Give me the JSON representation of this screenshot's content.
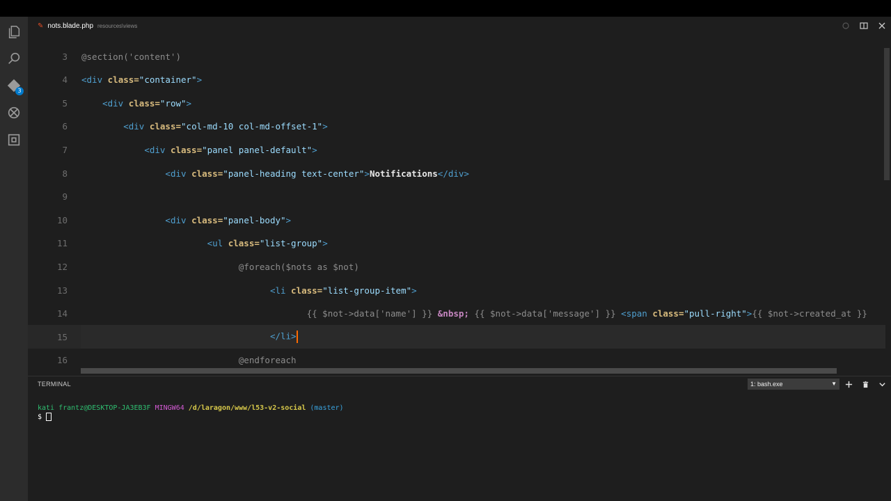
{
  "tab": {
    "filename": "nots.blade.php",
    "path": "resources\\views",
    "icon": "html-file-icon"
  },
  "activity_bar": {
    "items": [
      {
        "name": "explorer-icon"
      },
      {
        "name": "search-icon"
      },
      {
        "name": "source-control-icon",
        "badge": "3"
      },
      {
        "name": "debug-icon"
      },
      {
        "name": "extensions-icon"
      }
    ]
  },
  "editor": {
    "current_line": "15",
    "lines": [
      {
        "num": "3",
        "t": [
          [
            "blade",
            "@section('content')"
          ]
        ]
      },
      {
        "num": "4",
        "t": [
          [
            "tag",
            "<div "
          ],
          [
            "attr",
            "class="
          ],
          [
            "str",
            "\"container\""
          ],
          [
            "tag",
            ">"
          ]
        ]
      },
      {
        "num": "5",
        "t": [
          [
            "text",
            "    "
          ],
          [
            "tag",
            "<div "
          ],
          [
            "attr",
            "class="
          ],
          [
            "str",
            "\"row\""
          ],
          [
            "tag",
            ">"
          ]
        ]
      },
      {
        "num": "6",
        "t": [
          [
            "text",
            "        "
          ],
          [
            "tag",
            "<div "
          ],
          [
            "attr",
            "class="
          ],
          [
            "str",
            "\"col-md-10 col-md-offset-1\""
          ],
          [
            "tag",
            ">"
          ]
        ]
      },
      {
        "num": "7",
        "t": [
          [
            "text",
            "            "
          ],
          [
            "tag",
            "<div "
          ],
          [
            "attr",
            "class="
          ],
          [
            "str",
            "\"panel panel-default\""
          ],
          [
            "tag",
            ">"
          ]
        ]
      },
      {
        "num": "8",
        "t": [
          [
            "text",
            "                "
          ],
          [
            "tag",
            "<div "
          ],
          [
            "attr",
            "class="
          ],
          [
            "str",
            "\"panel-heading text-center\""
          ],
          [
            "tag",
            ">"
          ],
          [
            "text",
            "Notifications"
          ],
          [
            "tag",
            "</div>"
          ]
        ]
      },
      {
        "num": "9",
        "t": []
      },
      {
        "num": "10",
        "t": [
          [
            "text",
            "                "
          ],
          [
            "tag",
            "<div "
          ],
          [
            "attr",
            "class="
          ],
          [
            "str",
            "\"panel-body\""
          ],
          [
            "tag",
            ">"
          ]
        ]
      },
      {
        "num": "11",
        "t": [
          [
            "text",
            "                        "
          ],
          [
            "tag",
            "<ul "
          ],
          [
            "attr",
            "class="
          ],
          [
            "str",
            "\"list-group\""
          ],
          [
            "tag",
            ">"
          ]
        ]
      },
      {
        "num": "12",
        "t": [
          [
            "text",
            "                              "
          ],
          [
            "blade",
            "@foreach($nots as $not)"
          ]
        ]
      },
      {
        "num": "13",
        "t": [
          [
            "text",
            "                                    "
          ],
          [
            "tag",
            "<li "
          ],
          [
            "attr",
            "class="
          ],
          [
            "str",
            "\"list-group-item\""
          ],
          [
            "tag",
            ">"
          ]
        ]
      },
      {
        "num": "14",
        "t": [
          [
            "text",
            "                                           "
          ],
          [
            "dim",
            "{{ $not->data['name'] }} "
          ],
          [
            "ent",
            "&nbsp;"
          ],
          [
            "dim",
            " {{ $not->data['message'] }} "
          ],
          [
            "tag",
            "<span "
          ],
          [
            "attr",
            "class="
          ],
          [
            "str",
            "\"pull-right\""
          ],
          [
            "tag",
            ">"
          ],
          [
            "dim",
            "{{ $not->created_at }}"
          ]
        ]
      },
      {
        "num": "15",
        "t": [
          [
            "text",
            "                                    "
          ],
          [
            "tag",
            "</li>"
          ]
        ],
        "cursor": true
      },
      {
        "num": "16",
        "t": [
          [
            "text",
            "                              "
          ],
          [
            "blade",
            "@endforeach"
          ]
        ]
      }
    ]
  },
  "panel": {
    "title": "TERMINAL",
    "selected_terminal": "1: bash.exe",
    "actions": [
      "plus-icon",
      "trash-icon",
      "chevron-down-icon"
    ]
  },
  "terminal": {
    "user": "kati frantz",
    "host": "@DESKTOP-JA3EB3F",
    "system": "MINGW64",
    "path": "/d/laragon/www/l53-v2-social",
    "branch": "(master)",
    "prompt": "$"
  },
  "colors": {
    "background": "#1e1e1e",
    "activity_bar": "#2c2c2c",
    "cursor": "#ff6a00",
    "badge": "#007acc"
  }
}
